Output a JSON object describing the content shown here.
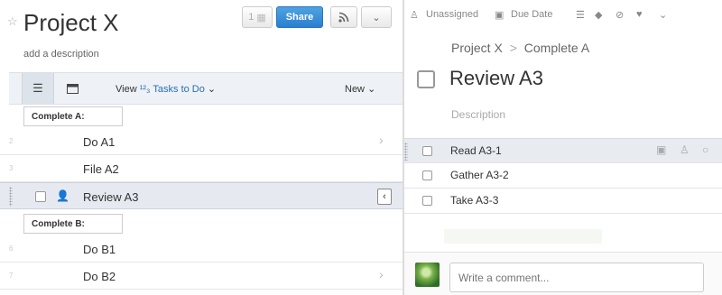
{
  "project": {
    "title": "Project X",
    "add_description": "add a description",
    "members_count": "1",
    "share_label": "Share"
  },
  "toolbar": {
    "view_label": "View",
    "sort_glyph": "¹²₃",
    "view_value": "Tasks to Do",
    "new_label": "New"
  },
  "sections": [
    {
      "header": "Complete A:",
      "rows": [
        {
          "num": "2",
          "label": "Do A1"
        },
        {
          "num": "3",
          "label": "File A2"
        },
        {
          "num": "",
          "label": "Review A3"
        }
      ]
    },
    {
      "header": "Complete B:",
      "rows": [
        {
          "num": "6",
          "label": "Do B1"
        },
        {
          "num": "7",
          "label": "Do B2"
        }
      ]
    }
  ],
  "detail": {
    "assignee": "Unassigned",
    "due_date": "Due Date",
    "breadcrumb_project": "Project X",
    "breadcrumb_sep": ">",
    "breadcrumb_section": "Complete A",
    "title": "Review A3",
    "description_placeholder": "Description",
    "subtasks": [
      {
        "label": "Read A3-1"
      },
      {
        "label": "Gather A3-2"
      },
      {
        "label": "Take A3-3"
      }
    ],
    "comment_placeholder": "Write a comment..."
  },
  "colors": {
    "accent": "#2a7fd0",
    "selected_row": "#e6eaf0"
  }
}
